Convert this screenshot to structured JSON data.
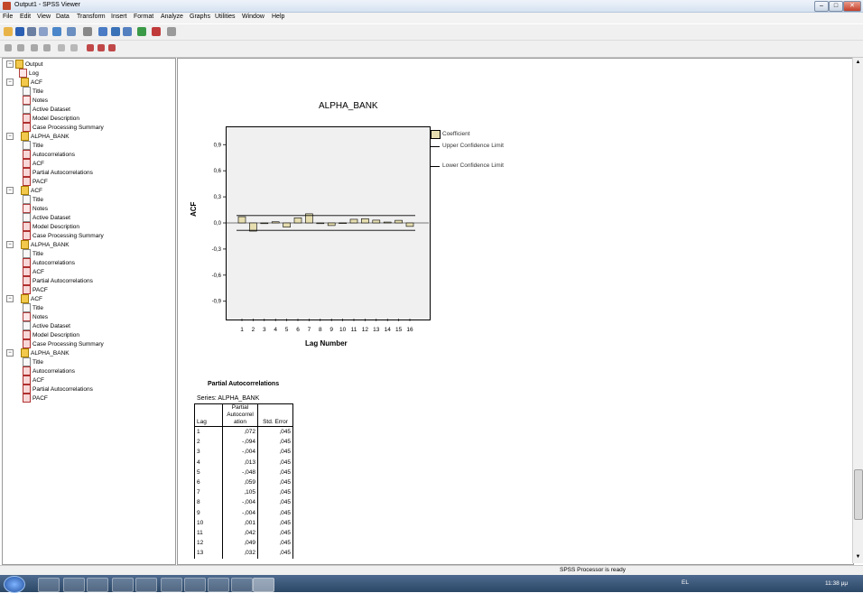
{
  "window": {
    "title": "Output1 - SPSS Viewer",
    "buttons": [
      "–",
      "□",
      "✕"
    ]
  },
  "menu": [
    "File",
    "Edit",
    "View",
    "Data",
    "Transform",
    "Insert",
    "Format",
    "Analyze",
    "Graphs",
    "Utilities",
    "Window",
    "Help"
  ],
  "tree": [
    {
      "label": "Output",
      "level": 0,
      "icon": "book",
      "expander": "−"
    },
    {
      "label": "Log",
      "level": 1,
      "icon": "note"
    },
    {
      "label": "ACF",
      "level": 1,
      "icon": "book",
      "expander": "−"
    },
    {
      "label": "Title",
      "level": 2,
      "icon": "doc"
    },
    {
      "label": "Notes",
      "level": 2,
      "icon": "note"
    },
    {
      "label": "Active Dataset",
      "level": 2,
      "icon": "doc"
    },
    {
      "label": "Model Description",
      "level": 2,
      "icon": "chart"
    },
    {
      "label": "Case Processing Summary",
      "level": 2,
      "icon": "chart"
    },
    {
      "label": "ALPHA_BANK",
      "level": 1,
      "icon": "book",
      "expander": "−"
    },
    {
      "label": "Title",
      "level": 2,
      "icon": "doc"
    },
    {
      "label": "Autocorrelations",
      "level": 2,
      "icon": "chart"
    },
    {
      "label": "ACF",
      "level": 2,
      "icon": "chart"
    },
    {
      "label": "Partial Autocorrelations",
      "level": 2,
      "icon": "chart"
    },
    {
      "label": "PACF",
      "level": 2,
      "icon": "chart"
    },
    {
      "label": "ACF",
      "level": 1,
      "icon": "book",
      "expander": "−"
    },
    {
      "label": "Title",
      "level": 2,
      "icon": "doc"
    },
    {
      "label": "Notes",
      "level": 2,
      "icon": "note"
    },
    {
      "label": "Active Dataset",
      "level": 2,
      "icon": "doc"
    },
    {
      "label": "Model Description",
      "level": 2,
      "icon": "chart"
    },
    {
      "label": "Case Processing Summary",
      "level": 2,
      "icon": "chart"
    },
    {
      "label": "ALPHA_BANK",
      "level": 1,
      "icon": "book",
      "expander": "−"
    },
    {
      "label": "Title",
      "level": 2,
      "icon": "doc"
    },
    {
      "label": "Autocorrelations",
      "level": 2,
      "icon": "chart"
    },
    {
      "label": "ACF",
      "level": 2,
      "icon": "chart"
    },
    {
      "label": "Partial Autocorrelations",
      "level": 2,
      "icon": "chart"
    },
    {
      "label": "PACF",
      "level": 2,
      "icon": "chart"
    },
    {
      "label": "ACF",
      "level": 1,
      "icon": "book",
      "expander": "−"
    },
    {
      "label": "Title",
      "level": 2,
      "icon": "doc"
    },
    {
      "label": "Notes",
      "level": 2,
      "icon": "note"
    },
    {
      "label": "Active Dataset",
      "level": 2,
      "icon": "doc"
    },
    {
      "label": "Model Description",
      "level": 2,
      "icon": "chart"
    },
    {
      "label": "Case Processing Summary",
      "level": 2,
      "icon": "chart"
    },
    {
      "label": "ALPHA_BANK",
      "level": 1,
      "icon": "book",
      "expander": "−"
    },
    {
      "label": "Title",
      "level": 2,
      "icon": "doc"
    },
    {
      "label": "Autocorrelations",
      "level": 2,
      "icon": "chart"
    },
    {
      "label": "ACF",
      "level": 2,
      "icon": "chart"
    },
    {
      "label": "Partial Autocorrelations",
      "level": 2,
      "icon": "chart"
    },
    {
      "label": "PACF",
      "level": 2,
      "icon": "chart"
    }
  ],
  "chart_data": {
    "type": "bar",
    "title": "ALPHA_BANK",
    "xlabel": "Lag Number",
    "ylabel": "ACF",
    "categories": [
      "1",
      "2",
      "3",
      "4",
      "5",
      "6",
      "7",
      "8",
      "9",
      "10",
      "11",
      "12",
      "13",
      "14",
      "15",
      "16"
    ],
    "series": [
      {
        "name": "Coefficient",
        "values": [
          0.072,
          -0.094,
          -0.004,
          0.013,
          -0.048,
          0.059,
          0.105,
          -0.004,
          -0.03,
          0.001,
          0.042,
          0.049,
          0.032,
          0.01,
          0.03,
          -0.04
        ]
      }
    ],
    "confidence_limits": {
      "upper": 0.085,
      "lower": -0.085
    },
    "yticks": [
      "0,9",
      "0,6",
      "0,3",
      "0,0",
      "-0,3",
      "-0,6",
      "-0,9"
    ],
    "ylim": [
      -1.1,
      1.1
    ],
    "legend": {
      "placement": "right",
      "entries": [
        "Coefficient",
        "Upper Confidence Limit",
        "Lower Confidence Limit"
      ]
    },
    "bar_color": "#e6deb0",
    "plot_background": "#f0f0f0"
  },
  "table": {
    "title": "Partial Autocorrelations",
    "series_label": "Series: ALPHA_BANK",
    "headers": [
      "Lag",
      "Partial Autocorrel ation",
      "Std. Error"
    ],
    "rows": [
      [
        "1",
        ",072",
        ",045"
      ],
      [
        "2",
        "-,094",
        ",045"
      ],
      [
        "3",
        "-,004",
        ",045"
      ],
      [
        "4",
        ",013",
        ",045"
      ],
      [
        "5",
        "-,048",
        ",045"
      ],
      [
        "6",
        ",059",
        ",045"
      ],
      [
        "7",
        ",105",
        ",045"
      ],
      [
        "8",
        "-,004",
        ",045"
      ],
      [
        "9",
        "-,004",
        ",045"
      ],
      [
        "10",
        ",001",
        ",045"
      ],
      [
        "11",
        ",042",
        ",045"
      ],
      [
        "12",
        ",049",
        ",045"
      ],
      [
        "13",
        ",032",
        ",045"
      ]
    ]
  },
  "status": {
    "text": "SPSS Processor is ready"
  },
  "taskbar": {
    "lang": "EL",
    "time": "11:38 μμ"
  },
  "colors": {
    "taskbar": "#2c4766",
    "titlebar": "#d6e2f1",
    "accent_icon": "#f2c94c"
  }
}
